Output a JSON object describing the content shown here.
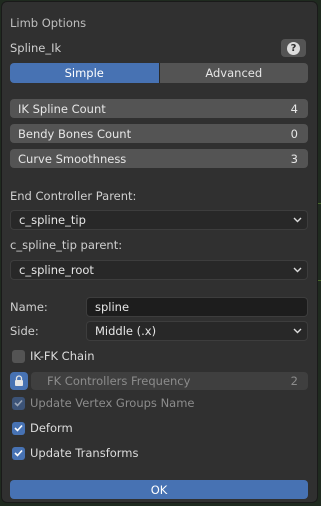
{
  "dialog": {
    "title": "Limb Options",
    "limb_type": "Spline_Ik",
    "help_icon": "question-circle-icon"
  },
  "tabs": {
    "simple_label": "Simple",
    "advanced_label": "Advanced",
    "active": "Simple"
  },
  "settings": [
    {
      "label": "IK Spline Count",
      "value": "4"
    },
    {
      "label": "Bendy Bones Count",
      "value": "0"
    },
    {
      "label": "Curve Smoothness",
      "value": "3"
    }
  ],
  "end_controller": {
    "label": "End Controller Parent:",
    "value": "c_spline_tip"
  },
  "tip_parent": {
    "label": "c_spline_tip parent:",
    "value": "c_spline_root"
  },
  "name_field": {
    "label": "Name:",
    "value": "spline"
  },
  "side_field": {
    "label": "Side:",
    "value": "Middle (.x)"
  },
  "ikfk_chain": {
    "label": "IK-FK Chain",
    "checked": false
  },
  "fk_frequency": {
    "label": "FK Controllers Frequency",
    "value": "2",
    "lock_icon": "lock-icon"
  },
  "update_vertex_groups": {
    "label": "Update Vertex Groups Name",
    "checked": true
  },
  "deform": {
    "label": "Deform",
    "checked": true
  },
  "update_transforms": {
    "label": "Update Transforms",
    "checked": true
  },
  "ok_label": "OK",
  "colors": {
    "accent": "#4772b3",
    "panel_bg": "#303030",
    "widget_bg": "#545454"
  }
}
